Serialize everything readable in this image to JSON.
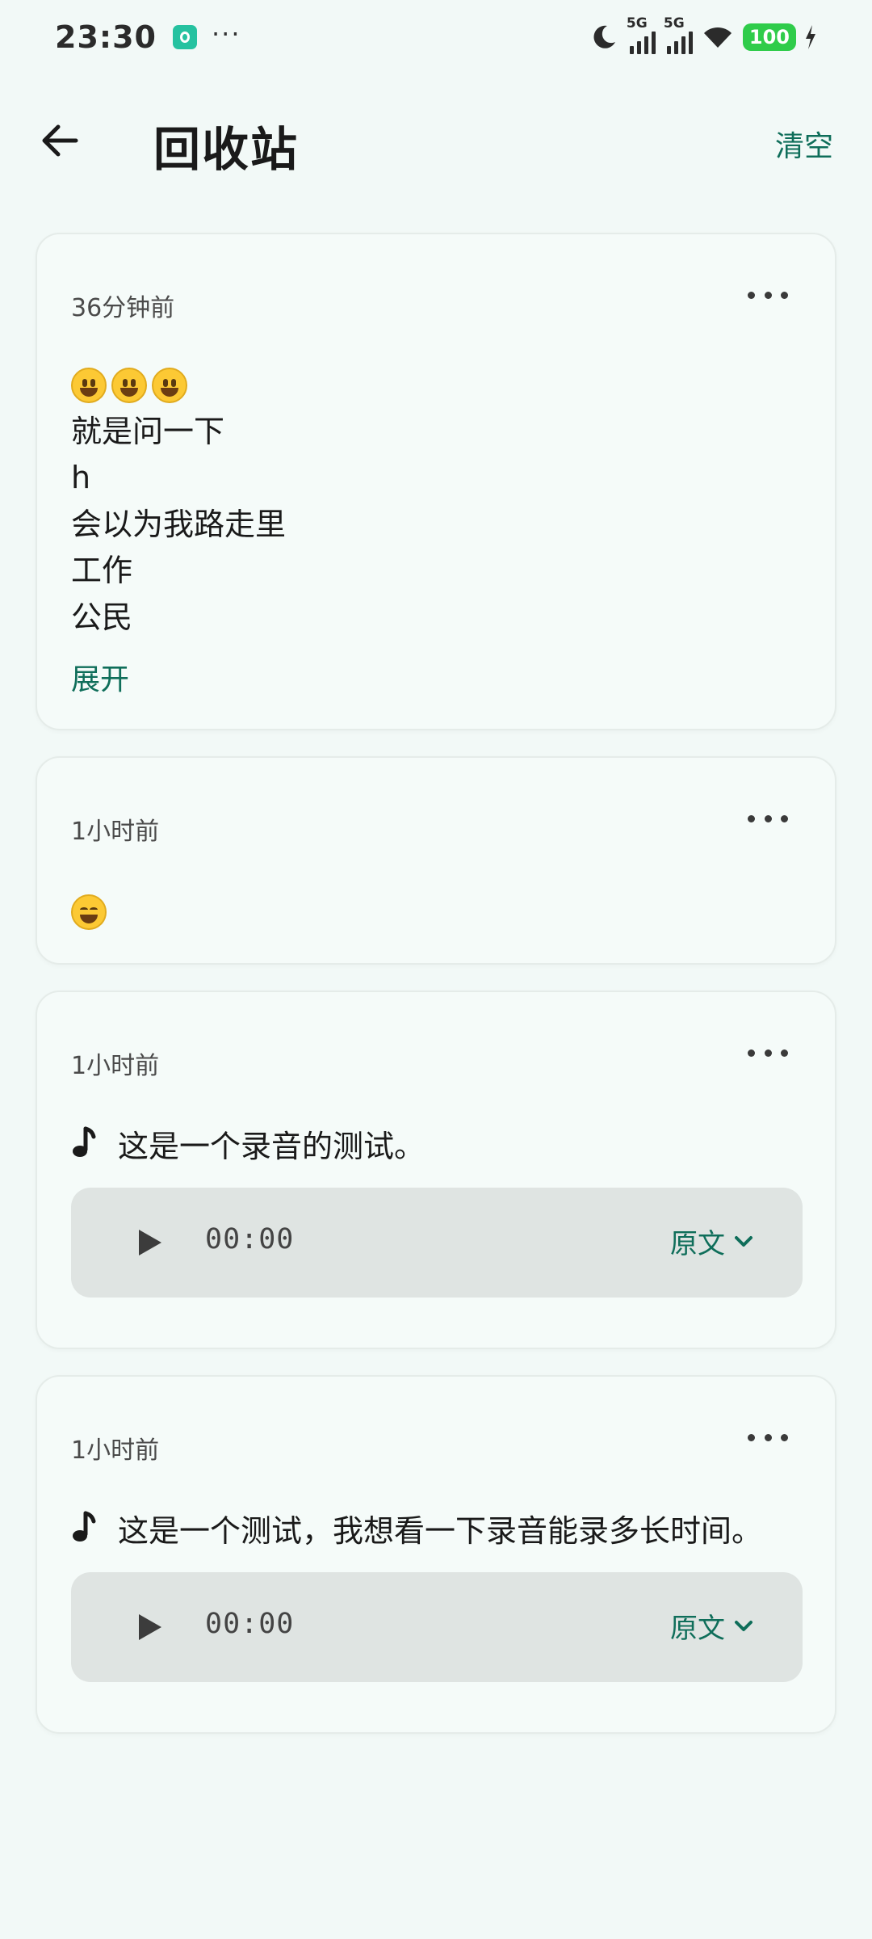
{
  "status_bar": {
    "time": "23:30",
    "more": "···",
    "net1": "5G",
    "net2": "5G",
    "battery": "100"
  },
  "header": {
    "title": "回收站",
    "clear_label": "清空"
  },
  "cards": [
    {
      "time": "36分钟前",
      "emoji_count": 3,
      "lines": [
        "就是问一下",
        "h",
        "会以为我路走里",
        "工作",
        "公民"
      ],
      "expand_label": "展开"
    },
    {
      "time": "1小时前",
      "emoji": "grinning-face"
    },
    {
      "time": "1小时前",
      "transcript": "这是一个录音的测试。",
      "duration": "00:00",
      "original_label": "原文"
    },
    {
      "time": "1小时前",
      "transcript": "这是一个测试，我想看一下录音能录多长时间。",
      "duration": "00:00",
      "original_label": "原文"
    }
  ],
  "colors": {
    "background": "#f2f9f7",
    "accent": "#0f6e5a",
    "card": "#f5fbf9",
    "player": "#dfe4e2",
    "battery": "#2fcc4a"
  }
}
